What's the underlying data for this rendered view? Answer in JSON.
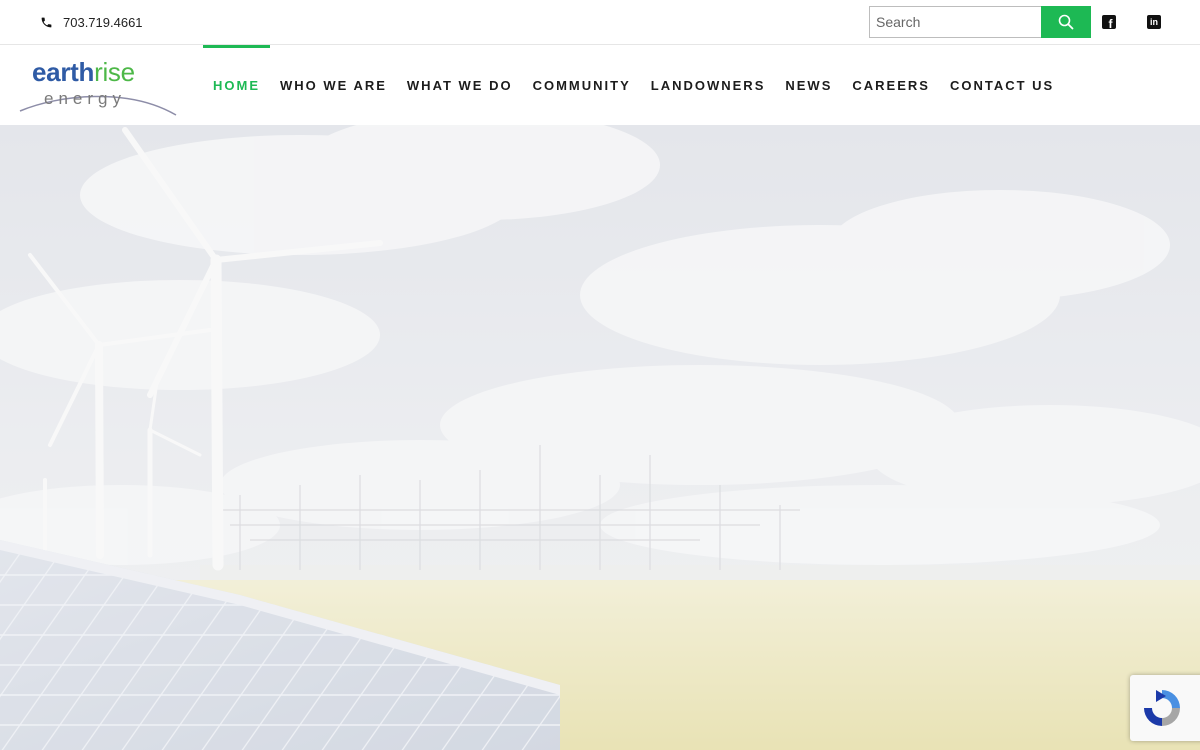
{
  "topbar": {
    "phone_icon": "phone-icon",
    "phone": "703.719.4661",
    "search": {
      "placeholder": "Search",
      "value": "",
      "button_icon": "search-icon"
    },
    "social": [
      {
        "name": "facebook",
        "icon": "facebook-icon"
      },
      {
        "name": "linkedin",
        "icon": "linkedin-icon"
      }
    ]
  },
  "logo": {
    "word_1": "earth",
    "word_2": "rise",
    "sub": "energy"
  },
  "nav": {
    "items": [
      {
        "label": "HOME",
        "active": true
      },
      {
        "label": "WHO WE ARE"
      },
      {
        "label": "WHAT WE DO"
      },
      {
        "label": "COMMUNITY"
      },
      {
        "label": "LANDOWNERS"
      },
      {
        "label": "NEWS"
      },
      {
        "label": "CAREERS"
      },
      {
        "label": "CONTACT US"
      }
    ]
  },
  "hero": {
    "image": "wind turbines, solar panels and substation over a yellow flower field"
  },
  "recaptcha": {
    "icon": "recaptcha-icon"
  },
  "colors": {
    "accent": "#1db954",
    "logo_blue": "#2f5ba5",
    "logo_green": "#4db848",
    "nav_text": "#1c1c1c"
  }
}
